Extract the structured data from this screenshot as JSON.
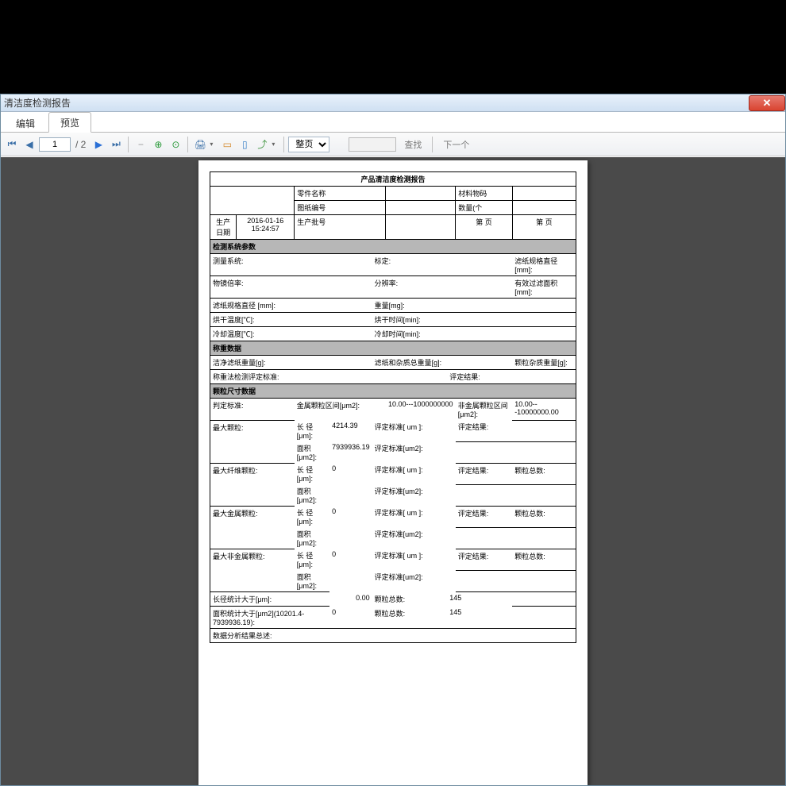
{
  "window": {
    "title": "清洁度检测报告"
  },
  "tabs": {
    "edit": "编辑",
    "preview": "预览"
  },
  "toolbar": {
    "current_page": "1",
    "page_sep": "/ 2",
    "zoom_label": "整页",
    "find_label": "查找",
    "next_label": "下一个"
  },
  "report": {
    "title": "产品清洁度检测报告",
    "hdr": {
      "part_name": "零件名称",
      "material_code": "材料物码",
      "drawing_no": "图纸编号",
      "qty": "数量(个",
      "prod_date_lbl": "生产日期",
      "prod_date_val": "2016-01-16 15:24:57",
      "prod_batch": "生产批号",
      "page_a": "第  页",
      "page_b": "第  页"
    },
    "sec1_title": "检测系统参数",
    "sec1": {
      "r1a": "测量系统:",
      "r1b": "标定:",
      "r1c": "滤纸规格直径 [mm]:",
      "r2a": "物镜倍率:",
      "r2b": "分辨率:",
      "r2c": "有效过滤面积 [mm]:",
      "r3a": "滤纸规格直径 [mm]:",
      "r3b": "重量[mg]:",
      "r4a": "烘干温度[℃]:",
      "r4b": "烘干时间[min]:",
      "r5a": "冷却温度[℃]:",
      "r5b": "冷却时间[min]:"
    },
    "sec2_title": "称重数据",
    "sec2": {
      "r1a": "洁净滤纸重量[g]:",
      "r1b": "滤纸和杂质总重量[g]:",
      "r1c": "颗粒杂质重量[g]:",
      "r2a": "称重法检测评定标准:",
      "r2b": "评定结果:"
    },
    "sec3_title": "颗粒尺寸数据",
    "sec3": {
      "judge_std": "判定标准:",
      "metal_zone": "金属颗粒区间[μm2]:",
      "range1": "10.00---1000000000",
      "nonmetal_zone": "非金属颗粒区间[μm2]:",
      "range2": "10.00---10000000.00",
      "p_max": "最大颗粒:",
      "p_fiber": "最大纤维颗粒:",
      "p_metal": "最大金属颗粒:",
      "p_nonmetal": "最大非金属颗粒:",
      "len_label": "长 径 [μm]:",
      "area_label": "面积 [μm2]:",
      "eval_um": "评定标准[ um ]:",
      "eval_um2": "评定标准[um2]:",
      "eval_result": "评定结果:",
      "particle_total": "颗粒总数:",
      "v_4214": "4214.39",
      "v_79399": "7939936.19",
      "v_0": "0",
      "len_stat": "长径统计大于[μm]:",
      "len_stat_v": "0.00",
      "area_stat": "面积统计大于[μm2](10201.4-7939936.19):",
      "area_stat_v": "0",
      "total145": "145",
      "analysis": "数据分析结果总述:"
    }
  }
}
